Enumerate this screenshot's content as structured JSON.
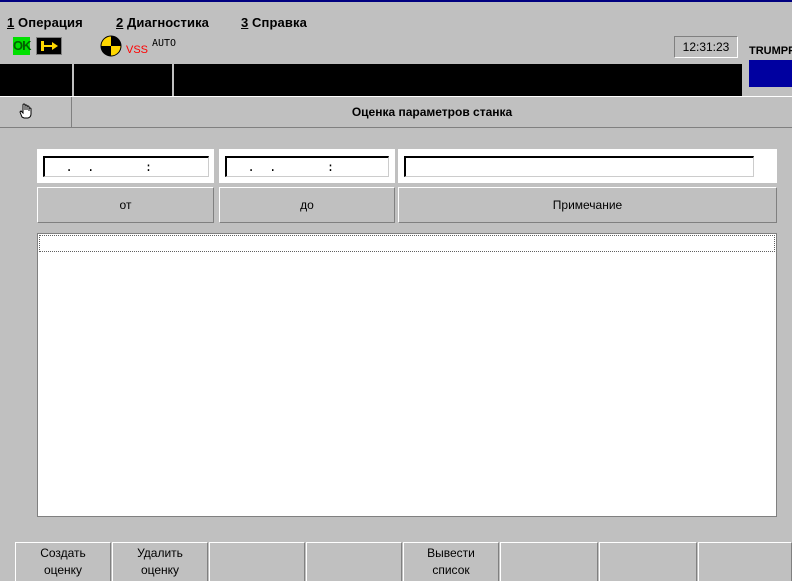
{
  "menu": {
    "items": [
      {
        "key": "1",
        "label": " Операция"
      },
      {
        "key": "2",
        "label": " Диагностика"
      },
      {
        "key": "3",
        "label": " Справка"
      }
    ]
  },
  "status": {
    "ok_label": "OK",
    "vss_label": "VSS",
    "mode_label": "AUTO",
    "clock": "12:31:23",
    "brand": "TRUMPF",
    "colors": {
      "ok": "#00e000",
      "vss": "#ff0000",
      "brand_block": "#0000a0",
      "target": "#ffd700"
    }
  },
  "title": {
    "icon": "hand-icon",
    "text": "Оценка параметров станка"
  },
  "filter": {
    "from_value": "  .  .       :",
    "to_value": "  .  .       :",
    "note_value": ""
  },
  "headers": {
    "from": "от",
    "to": "до",
    "note": "Примечание"
  },
  "list": {
    "rows": []
  },
  "softkeys": [
    {
      "line1": "Создать",
      "line2": "оценку"
    },
    {
      "line1": "Удалить",
      "line2": "оценку"
    },
    {
      "line1": "",
      "line2": ""
    },
    {
      "line1": "",
      "line2": ""
    },
    {
      "line1": "Вывести",
      "line2": "список"
    },
    {
      "line1": "",
      "line2": ""
    },
    {
      "line1": "",
      "line2": ""
    },
    {
      "line1": "",
      "line2": ""
    }
  ]
}
